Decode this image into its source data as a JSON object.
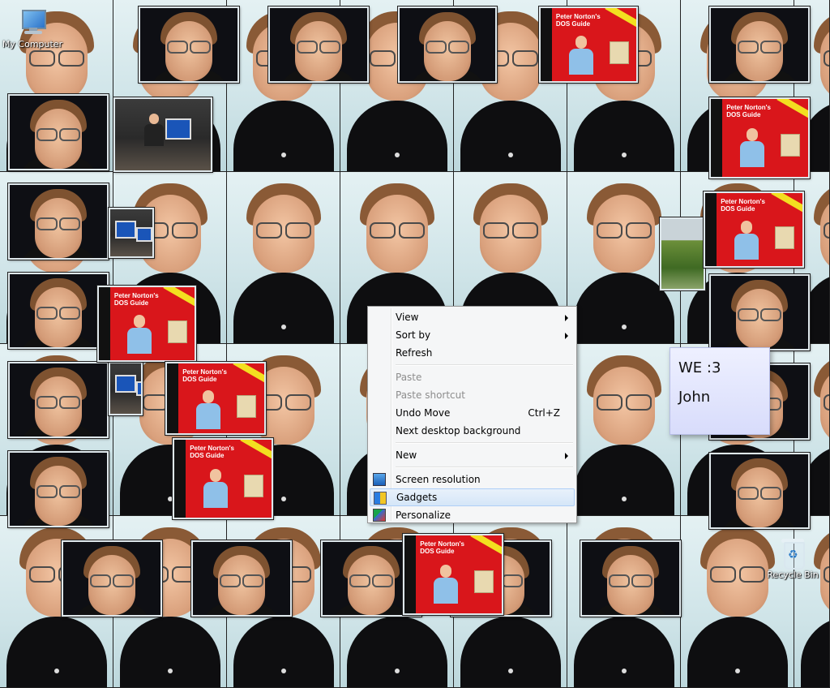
{
  "desktop_icons": [
    {
      "id": "my-computer",
      "label": "My Computer",
      "icon": "computer-icon"
    },
    {
      "id": "recycle-bin",
      "label": "Recycle Bin",
      "icon": "recycle-bin-icon"
    }
  ],
  "book": {
    "title_line1": "Peter Norton's",
    "title_line2": "DOS Guide"
  },
  "sticky_note": {
    "line1": "WE :3",
    "line2": "John"
  },
  "context_menu": {
    "items": [
      {
        "label": "View",
        "submenu": true
      },
      {
        "label": "Sort by",
        "submenu": true
      },
      {
        "label": "Refresh"
      },
      {
        "label": "Paste",
        "disabled": true
      },
      {
        "label": "Paste shortcut",
        "disabled": true
      },
      {
        "label": "Undo Move",
        "shortcut": "Ctrl+Z"
      },
      {
        "label": "Next desktop background"
      },
      {
        "label": "New",
        "submenu": true
      },
      {
        "label": "Screen resolution",
        "icon": "screen-resolution-icon"
      },
      {
        "label": "Gadgets",
        "icon": "gadgets-icon",
        "highlighted": true
      },
      {
        "label": "Personalize",
        "icon": "personalize-icon"
      }
    ]
  }
}
